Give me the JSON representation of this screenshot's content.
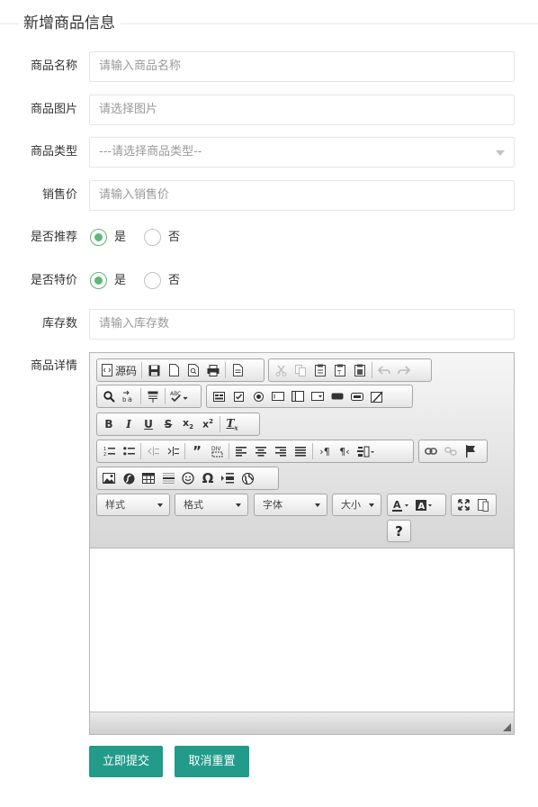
{
  "form": {
    "legend": "新增商品信息",
    "name": {
      "label": "商品名称",
      "placeholder": "请输入商品名称"
    },
    "image": {
      "label": "商品图片",
      "placeholder": "请选择图片"
    },
    "type": {
      "label": "商品类型",
      "selected": "---请选择商品类型--"
    },
    "price": {
      "label": "销售价",
      "placeholder": "请输入销售价"
    },
    "recommend": {
      "label": "是否推荐",
      "options": [
        "是",
        "否"
      ],
      "selected": "是"
    },
    "special": {
      "label": "是否特价",
      "options": [
        "是",
        "否"
      ],
      "selected": "是"
    },
    "stock": {
      "label": "库存数",
      "placeholder": "请输入库存数"
    },
    "detail": {
      "label": "商品详情"
    },
    "submit_label": "立即提交",
    "reset_label": "取消重置"
  },
  "editor": {
    "source_label": "源码",
    "combos": {
      "style": "样式",
      "format": "格式",
      "font": "字体",
      "size": "大小"
    },
    "help_label": "?",
    "accent": "#5FB878",
    "button_color": "#229b8a"
  }
}
